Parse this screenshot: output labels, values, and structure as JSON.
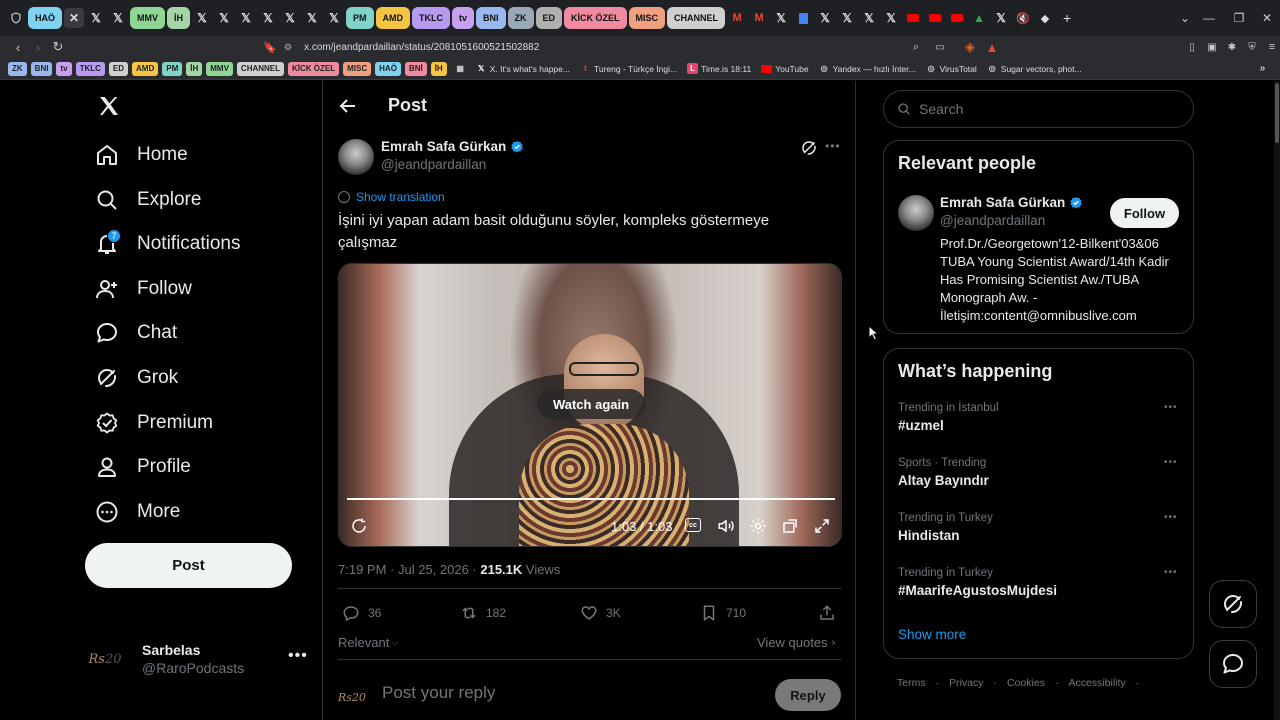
{
  "browser": {
    "tab_groups": [
      {
        "label": "HAÖ",
        "color": "#7fd3f0"
      },
      {
        "label": "MMV",
        "color": "#8fd694"
      },
      {
        "label": "İH",
        "color": "#a5d6a7"
      },
      {
        "label": "PM",
        "color": "#7fd3c7"
      },
      {
        "label": "AMD",
        "color": "#f5c542"
      },
      {
        "label": "TKLC",
        "color": "#b59af0"
      },
      {
        "label": "tv",
        "color": "#c8a0f0"
      },
      {
        "label": "BNI",
        "color": "#9ab8f0"
      },
      {
        "label": "ZK",
        "color": "#9aa8b8"
      },
      {
        "label": "ED",
        "color": "#b0b0b0"
      },
      {
        "label": "KİCK ÖZEL",
        "color": "#f08aa0"
      },
      {
        "label": "MISC",
        "color": "#f0a080"
      },
      {
        "label": "CHANNEL",
        "color": "#cfcfcf"
      }
    ],
    "url": "x.com/jeandpardaillan/status/2081051600521502882",
    "bookmark_tags": [
      {
        "label": "ZK",
        "color": "#9ab8f0"
      },
      {
        "label": "BNI",
        "color": "#9ab8f0"
      },
      {
        "label": "tv",
        "color": "#c8a0f0"
      },
      {
        "label": "TKLC",
        "color": "#b59af0"
      },
      {
        "label": "ED",
        "color": "#cfcfcf"
      },
      {
        "label": "AMD",
        "color": "#f5c542"
      },
      {
        "label": "PM",
        "color": "#7fd3c7"
      },
      {
        "label": "İH",
        "color": "#a5d6a7"
      },
      {
        "label": "MMV",
        "color": "#8fd694"
      },
      {
        "label": "CHANNEL",
        "color": "#cfcfcf"
      },
      {
        "label": "KİCK ÖZEL",
        "color": "#f08aa0"
      },
      {
        "label": "MISC",
        "color": "#f0a080"
      },
      {
        "label": "HAÖ",
        "color": "#7fd3f0"
      },
      {
        "label": "BNİ",
        "color": "#f08aa0"
      },
      {
        "label": "İH",
        "color": "#f5c542"
      }
    ],
    "bookmark_links": [
      {
        "label": "X. It's what's happe...",
        "icon": "x-icon"
      },
      {
        "label": "Tureng - Türkçe İngi...",
        "icon": "tureng-icon"
      },
      {
        "label": "Time.is 18:11",
        "icon": "timeis-icon"
      },
      {
        "label": "YouTube",
        "icon": "youtube-icon"
      },
      {
        "label": "Yandex — hızlı İnter...",
        "icon": "yandex-icon"
      },
      {
        "label": "VirusTotal",
        "icon": "virustotal-icon"
      },
      {
        "label": "Sugar vectors, phot...",
        "icon": "globe-icon"
      }
    ]
  },
  "nav": {
    "items": [
      {
        "label": "Home",
        "icon": "home-icon"
      },
      {
        "label": "Explore",
        "icon": "search-icon"
      },
      {
        "label": "Notifications",
        "icon": "bell-icon",
        "badge": "7"
      },
      {
        "label": "Follow",
        "icon": "follow-icon"
      },
      {
        "label": "Chat",
        "icon": "chat-icon"
      },
      {
        "label": "Grok",
        "icon": "grok-icon"
      },
      {
        "label": "Premium",
        "icon": "premium-icon"
      },
      {
        "label": "Profile",
        "icon": "profile-icon"
      },
      {
        "label": "More",
        "icon": "more-icon"
      }
    ],
    "post_label": "Post",
    "account": {
      "name": "Sarbelas",
      "handle": "@RaroPodcasts"
    }
  },
  "post": {
    "header_title": "Post",
    "author_name": "Emrah Safa Gürkan",
    "author_handle": "@jeandpardaillan",
    "show_translation": "Show translation",
    "text": "İşini iyi yapan adam basit olduğunu söyler, kompleks göstermeye çalışmaz",
    "video": {
      "watch_again": "Watch again",
      "time": "1:03 / 1:03",
      "progress": 1.0
    },
    "meta_time": "7:19 PM · Jul 25, 2026 · ",
    "views_count": "215.1K",
    "views_label": " Views",
    "stats": {
      "replies": "36",
      "reposts": "182",
      "likes": "3K",
      "bookmarks": "710"
    },
    "sort_label": "Relevant",
    "view_quotes": "View quotes",
    "reply_placeholder": "Post your reply",
    "reply_button": "Reply"
  },
  "search": {
    "placeholder": "Search"
  },
  "relevant": {
    "title": "Relevant people",
    "name": "Emrah Safa Gürkan",
    "handle": "@jeandpardaillan",
    "follow_label": "Follow",
    "bio": "Prof.Dr./Georgetown'12-Bilkent'03&06 TUBA Young Scientist Award/14th Kadir Has Promising Scientist Aw./TUBA Monograph Aw. - İletişim:content@omnibuslive.com"
  },
  "happening": {
    "title": "What’s happening",
    "trends": [
      {
        "context": "Trending in İstanbul",
        "name": "#uzmel"
      },
      {
        "context": "Sports · Trending",
        "name": "Altay Bayındır"
      },
      {
        "context": "Trending in Turkey",
        "name": "Hindistan"
      },
      {
        "context": "Trending in Turkey",
        "name": "#MaarifeAgustosMujdesi"
      }
    ],
    "show_more": "Show more"
  },
  "footer": {
    "links": [
      "Terms",
      "Privacy",
      "Cookies",
      "Accessibility"
    ]
  },
  "colors": {
    "accent": "#1d9bf0",
    "muted": "#71767b",
    "border": "#2f3336"
  }
}
